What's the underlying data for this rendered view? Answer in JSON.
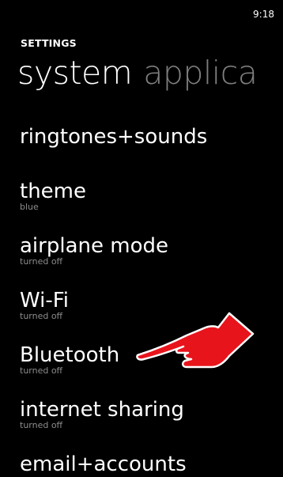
{
  "status_bar": {
    "time": "9:18"
  },
  "header": {
    "app_title": "SETTINGS",
    "pivot_active": "system",
    "pivot_next": "applica"
  },
  "settings": [
    {
      "label": "ringtones+sounds",
      "sub": ""
    },
    {
      "label": "theme",
      "sub": "blue"
    },
    {
      "label": "airplane mode",
      "sub": "turned off"
    },
    {
      "label": "Wi-Fi",
      "sub": "turned off"
    },
    {
      "label": "Bluetooth",
      "sub": "turned off"
    },
    {
      "label": "internet sharing",
      "sub": "turned off"
    },
    {
      "label": "email+accounts",
      "sub": ""
    }
  ],
  "pointer": {
    "icon": "pointing-hand-icon",
    "color": "#e8141c"
  }
}
